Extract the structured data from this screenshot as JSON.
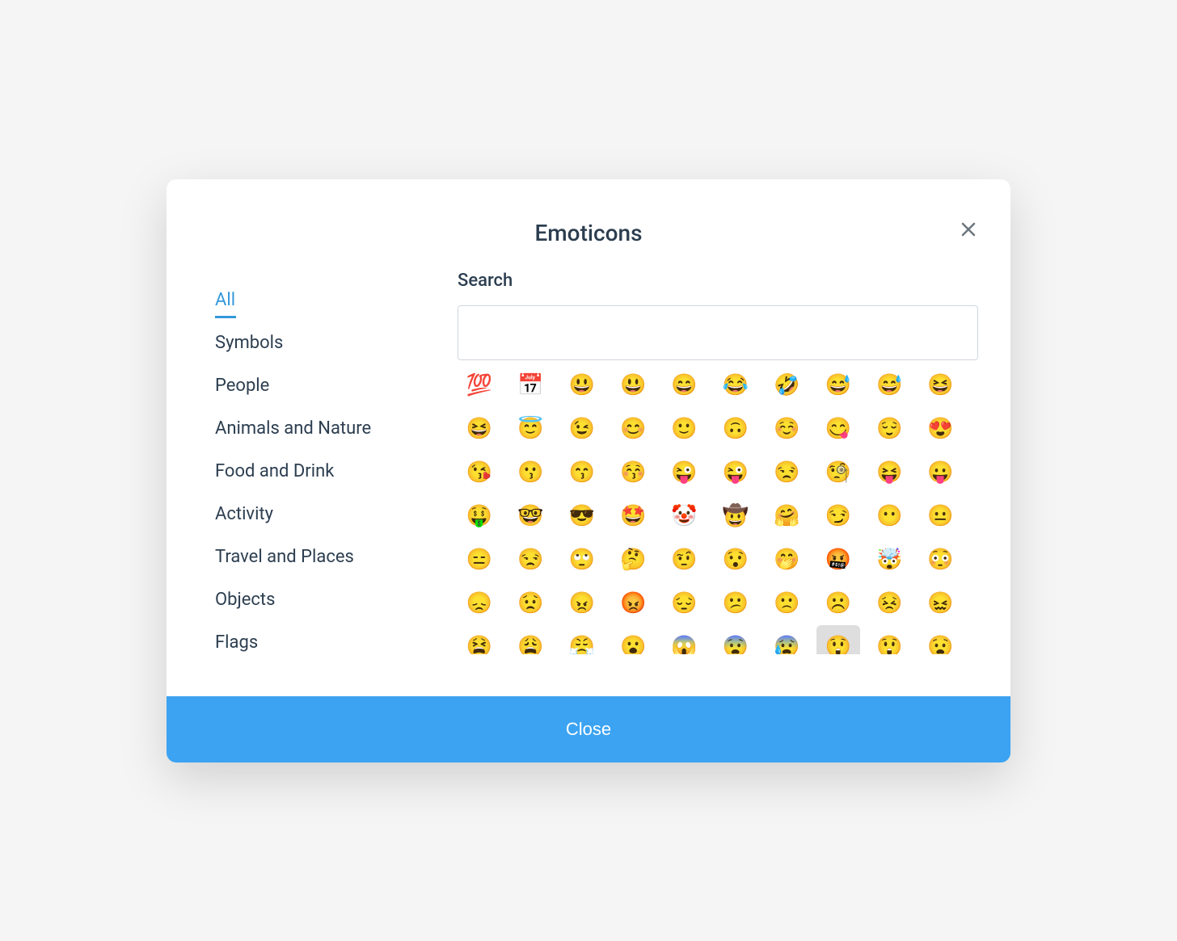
{
  "modal": {
    "title": "Emoticons",
    "close_button_label": "Close"
  },
  "search": {
    "label": "Search",
    "value": ""
  },
  "sidebar": {
    "items": [
      {
        "label": "All",
        "active": true
      },
      {
        "label": "Symbols",
        "active": false
      },
      {
        "label": "People",
        "active": false
      },
      {
        "label": "Animals and Nature",
        "active": false
      },
      {
        "label": "Food and Drink",
        "active": false
      },
      {
        "label": "Activity",
        "active": false
      },
      {
        "label": "Travel and Places",
        "active": false
      },
      {
        "label": "Objects",
        "active": false
      },
      {
        "label": "Flags",
        "active": false
      }
    ]
  },
  "emojis": {
    "highlighted_index": 67,
    "items": [
      "💯",
      "📅",
      "😃",
      "😃",
      "😄",
      "😂",
      "🤣",
      "😅",
      "😅",
      "😆",
      "😆",
      "😇",
      "😉",
      "😊",
      "🙂",
      "🙃",
      "☺️",
      "😋",
      "😌",
      "😍",
      "😘",
      "😗",
      "😙",
      "😚",
      "😜",
      "😜",
      "😒",
      "🧐",
      "😝",
      "😛",
      "🤑",
      "🤓",
      "😎",
      "🤩",
      "🤡",
      "🤠",
      "🤗",
      "😏",
      "😶",
      "😐",
      "😑",
      "😒",
      "🙄",
      "🤔",
      "🤨",
      "😯",
      "🤭",
      "🤬",
      "🤯",
      "😳",
      "😞",
      "😟",
      "😠",
      "😡",
      "😔",
      "😕",
      "🙁",
      "☹️",
      "😣",
      "😖",
      "😫",
      "😩",
      "😤",
      "😮",
      "😱",
      "😨",
      "😰",
      "😲",
      "😲",
      "😧"
    ]
  }
}
